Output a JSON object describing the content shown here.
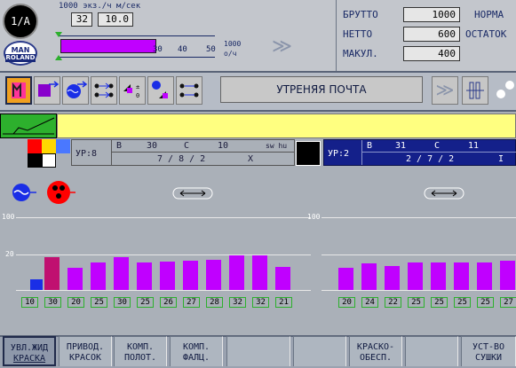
{
  "header": {
    "status_badge": "1/A",
    "logo_line1": "MAN",
    "logo_line2": "ROLAND",
    "speed_caption": "1000 экз./ч м/сек",
    "speed_value": "32",
    "speed_ms": "10.0",
    "slider_ticks": [
      "30",
      "40",
      "50"
    ],
    "slider_unit_top": "1000",
    "slider_unit_bottom": "о/ч",
    "speed_fill_fraction": 0.6,
    "counter_labels": {
      "gross": "БРУТТО",
      "net": "НЕТТО",
      "waste": "МАКУЛ."
    },
    "counter_values": {
      "gross": "1000",
      "net": "600",
      "waste": "400"
    },
    "right_labels": {
      "norm": "НОРМА",
      "rest": "ОСТАТОК"
    }
  },
  "toolbar": {
    "job_name": "УТРЕНЯЯ ПОЧТА",
    "icons": [
      "ink-fountain-icon",
      "water-to-ink-icon",
      "dampening-icon",
      "roller-link-icon",
      "ink-key-zero-icon",
      "water-ink-key-icon",
      "roller-link-2-icon"
    ]
  },
  "units": [
    {
      "label": "УР:8",
      "b": "В",
      "b_val": "30",
      "c": "С",
      "c_val": "10",
      "extra": "sw hu",
      "row2": "7 / 8 / 2",
      "row2b": "Х"
    },
    {
      "label": "УР:2",
      "b": "В",
      "b_val": "31",
      "c": "С",
      "c_val": "11",
      "extra": "",
      "row2": "2 / 7 / 2",
      "row2b": "I"
    }
  ],
  "chart_data": {
    "type": "bar",
    "ylim": [
      0,
      100
    ],
    "yticks": [
      "100",
      "20",
      "100"
    ],
    "left": {
      "labels": [
        "10",
        "30",
        "20",
        "25",
        "30",
        "25",
        "26",
        "27",
        "28",
        "32",
        "32",
        "21"
      ],
      "values": [
        10,
        30,
        20,
        25,
        30,
        25,
        26,
        27,
        28,
        32,
        32,
        21
      ],
      "colors": [
        "#1a2ee6",
        "#c01070",
        "#c000ff",
        "#c000ff",
        "#c000ff",
        "#c000ff",
        "#c000ff",
        "#c000ff",
        "#c000ff",
        "#c000ff",
        "#c000ff",
        "#c000ff"
      ]
    },
    "right": {
      "labels": [
        "20",
        "24",
        "22",
        "25",
        "25",
        "25",
        "25",
        "27"
      ],
      "values": [
        20,
        24,
        22,
        25,
        25,
        25,
        25,
        27
      ],
      "colors": [
        "#c000ff",
        "#c000ff",
        "#c000ff",
        "#c000ff",
        "#c000ff",
        "#c000ff",
        "#c000ff",
        "#c000ff"
      ]
    }
  },
  "footer": {
    "buttons": [
      {
        "line1": "УВЛ.ЖИД",
        "line2": "КРАСКА"
      },
      {
        "line1": "ПРИВОД.",
        "line2": "КРАСОК"
      },
      {
        "line1": "КОМП.",
        "line2": "ПОЛОТ."
      },
      {
        "line1": "КОМП.",
        "line2": "ФАЛЦ."
      },
      {
        "line1": "",
        "line2": ""
      },
      {
        "line1": "",
        "line2": ""
      },
      {
        "line1": "КРАСКО-",
        "line2": "ОБЕСП."
      },
      {
        "line1": "",
        "line2": ""
      },
      {
        "line1": "УСТ-ВО",
        "line2": "СУШКИ"
      }
    ]
  },
  "colors": {
    "magenta": "#c000ff",
    "yellow": "#ffff80",
    "green": "#2db02d",
    "blue": "#1a2ee6"
  }
}
